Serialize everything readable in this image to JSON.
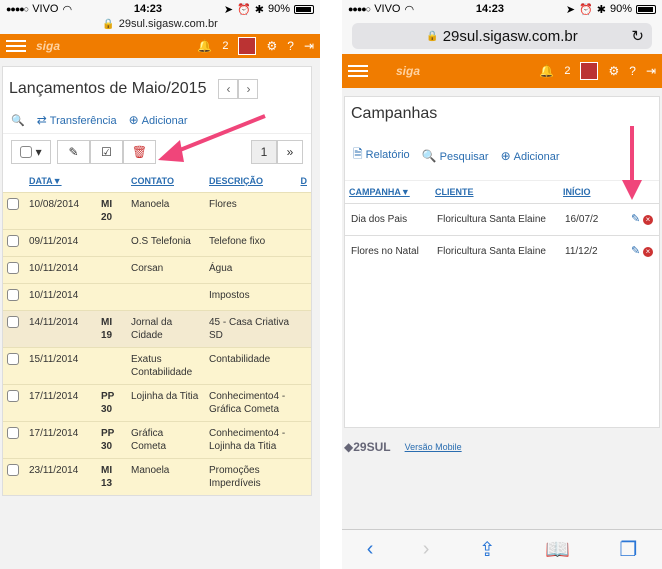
{
  "status": {
    "carrier": "VIVO",
    "time": "14:23",
    "battery": "90%"
  },
  "left": {
    "url": "29sul.sigasw.com.br",
    "notif_count": "2",
    "title": "Lançamentos de Maio/2015",
    "actions": {
      "transfer": "Transferência",
      "add": "Adicionar"
    },
    "pagination": {
      "current": "1",
      "next": "»"
    },
    "columns": [
      "DATA▼",
      "CONTATO",
      "DESCRIÇÃO",
      "D"
    ],
    "rows": [
      {
        "date": "10/08/2014",
        "code": "MI 20",
        "contact": "Manoela",
        "desc": "Flores"
      },
      {
        "date": "09/11/2014",
        "code": "",
        "contact": "O.S Telefonia",
        "desc": "Telefone fixo"
      },
      {
        "date": "10/11/2014",
        "code": "",
        "contact": "Corsan",
        "desc": "Água"
      },
      {
        "date": "10/11/2014",
        "code": "",
        "contact": "",
        "desc": "Impostos"
      },
      {
        "date": "14/11/2014",
        "code": "MI 19",
        "contact": "Jornal da Cidade",
        "desc": "45 - Casa Criativa SD"
      },
      {
        "date": "15/11/2014",
        "code": "",
        "contact": "Exatus Contabilidade",
        "desc": "Contabilidade"
      },
      {
        "date": "17/11/2014",
        "code": "PP 30",
        "contact": "Lojinha da Titia",
        "desc": "Conhecimento4 - Gráfica Cometa"
      },
      {
        "date": "17/11/2014",
        "code": "PP 30",
        "contact": "Gráfica Cometa",
        "desc": "Conhecimento4 - Lojinha da Titia"
      },
      {
        "date": "23/11/2014",
        "code": "MI 13",
        "contact": "Manoela",
        "desc": "Promoções Imperdíveis"
      }
    ]
  },
  "right": {
    "url": "29sul.sigasw.com.br",
    "notif_count": "2",
    "title": "Campanhas",
    "actions": {
      "report": "Relatório",
      "search": "Pesquisar",
      "add": "Adicionar"
    },
    "columns": [
      "CAMPANHA▼",
      "CLIENTE",
      "INÍCIO"
    ],
    "rows": [
      {
        "name": "Dia dos Pais",
        "client": "Floricultura Santa Elaine",
        "start": "16/07/2"
      },
      {
        "name": "Flores no Natal",
        "client": "Floricultura Santa Elaine",
        "start": "11/12/2"
      }
    ],
    "footer": {
      "brand": "29SUL",
      "mobile": "Versão Mobile"
    }
  },
  "colors": {
    "orange": "#f07c00",
    "link": "#2a6db0",
    "arrow": "#f0457a"
  },
  "icons": [
    "search-icon",
    "transfer-icon",
    "plus-icon",
    "pencil-icon",
    "check-icon",
    "trash-icon",
    "bell-icon",
    "gear-icon",
    "help-icon",
    "logout-icon",
    "report-icon",
    "delete-icon",
    "back-icon",
    "forward-icon",
    "share-icon",
    "bookmarks-icon",
    "tabs-icon"
  ]
}
